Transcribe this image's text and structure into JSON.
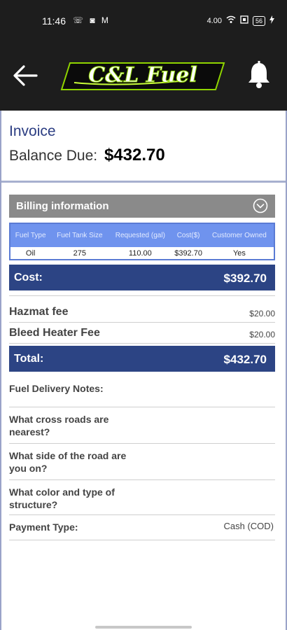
{
  "status_bar": {
    "time": "11:46",
    "left_icons_text": "☏ ◙ M",
    "network_text": "4.00",
    "battery": "56"
  },
  "header": {
    "logo_text": "C&L Fuel",
    "icons": [
      "back-arrow-icon",
      "bell-icon"
    ]
  },
  "invoice": {
    "title": "Invoice",
    "balance_label": "Balance Due:",
    "balance_amount": "$432.70"
  },
  "billing": {
    "header_label": "Billing information",
    "collapse_icon": "chevron-down-circle-icon",
    "columns": [
      "Fuel Type",
      "Fuel Tank Size",
      "Requested (gal)",
      "Cost($)",
      "Customer Owned"
    ],
    "row": [
      "Oil",
      "275",
      "110.00",
      "$392.70",
      "Yes"
    ]
  },
  "cost": {
    "label": "Cost:",
    "value": "$392.70"
  },
  "fees": [
    {
      "label": "Hazmat fee",
      "value": "$20.00"
    },
    {
      "label": "Bleed Heater Fee",
      "value": "$20.00"
    }
  ],
  "total": {
    "label": "Total:",
    "value": "$432.70"
  },
  "notes": {
    "delivery_notes_label": "Fuel Delivery Notes:",
    "cross_roads_label": "What cross roads are nearest?",
    "road_side_label": "What side of the road are you on?",
    "structure_label": "What color and type of structure?",
    "payment_label": "Payment Type:",
    "payment_value": "Cash (COD)"
  },
  "colors": {
    "header_bg": "#1d1d1d",
    "accent_navy": "#2c4484",
    "table_header": "#6f93ee",
    "section_gray": "#8a8a8a",
    "title_blue": "#2b3d82"
  }
}
